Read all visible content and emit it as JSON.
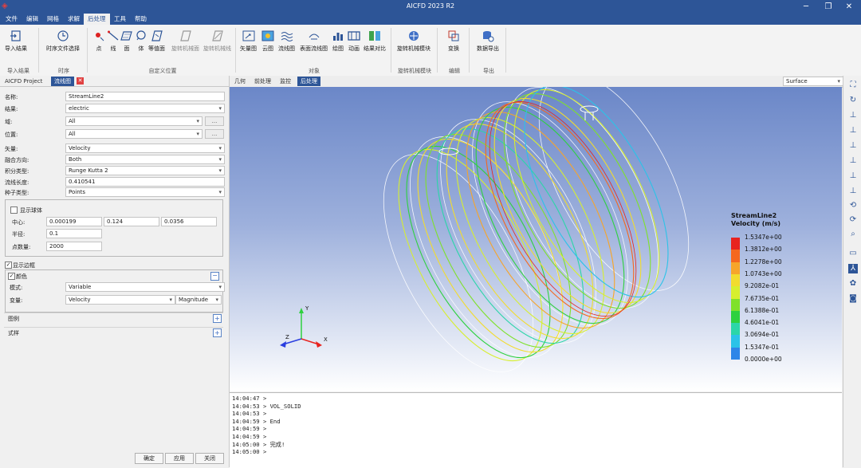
{
  "window": {
    "title": "AICFD 2023 R2"
  },
  "menu": [
    "文件",
    "编辑",
    "网格",
    "求解",
    "后处理",
    "工具",
    "帮助"
  ],
  "menu_active_index": 4,
  "ribbon": {
    "buttons": {
      "import_result": "导入结果",
      "time_file": "时序文件选择",
      "point": "点",
      "line": "线",
      "plane": "面",
      "volume": "体",
      "isosurface": "等值面",
      "rot_mach_surface": "旋转机械面",
      "rot_mach_line": "旋转机械线",
      "vector": "矢量图",
      "contour": "云图",
      "streamline": "流线图",
      "surface_streamline": "表面流线图",
      "plot": "绘图",
      "animation": "动画",
      "compare": "结果对比",
      "rot_mach_module": "旋转机械模块",
      "transform": "变换",
      "data_export": "数据导出"
    },
    "groups": {
      "import": "导入结果",
      "timing": "时序",
      "custom_position": "自定义位置",
      "object": "对象",
      "rot_mach": "旋转机械模块",
      "edit": "编辑",
      "export": "导出"
    }
  },
  "left_panel": {
    "tabs": [
      "AICFD Project",
      "流线图"
    ],
    "fields": {
      "name_label": "名称:",
      "name_value": "StreamLine2",
      "result_label": "结果:",
      "result_value": "electric",
      "domain_label": "域:",
      "domain_value": "All",
      "position_label": "位置:",
      "position_value": "All",
      "vector_label": "矢量:",
      "vector_value": "Velocity",
      "direction_label": "融合方向:",
      "direction_value": "Both",
      "integ_label": "积分类型:",
      "integ_value": "Runge Kutta 2",
      "length_label": "流线长度:",
      "length_value": "0.410541",
      "seed_label": "种子类型:",
      "seed_value": "Points",
      "ellipsis": "..."
    },
    "sphere": {
      "show_label": "显示球体",
      "center_label": "中心:",
      "center": [
        "0.000199",
        "0.124",
        "0.0356"
      ],
      "radius_label": "半径:",
      "radius": "0.1",
      "points_label": "点数量:",
      "points": "2000"
    },
    "show_border": "显示边框",
    "color": {
      "title": "颜色",
      "mode_label": "模式:",
      "mode_value": "Variable",
      "var_label": "变量:",
      "var_value": "Velocity",
      "component": "Magnitude"
    },
    "legend_section": "图例",
    "style_section": "式样",
    "buttons": {
      "ok": "确定",
      "apply": "应用",
      "close": "关闭"
    }
  },
  "view_tabs": [
    "几何",
    "前处理",
    "监控",
    "后处理"
  ],
  "view_active_index": 3,
  "view_mode": "Surface",
  "legend": {
    "title1": "StreamLine2",
    "title2": "Velocity (m/s)",
    "labels": [
      "1.5347e+00",
      "1.3812e+00",
      "1.2278e+00",
      "1.0743e+00",
      "9.2082e-01",
      "7.6735e-01",
      "6.1388e-01",
      "4.6041e-01",
      "3.0694e-01",
      "1.5347e-01",
      "0.0000e+00"
    ],
    "colors": [
      "#e8231f",
      "#f5681f",
      "#f7a52a",
      "#f2dc2e",
      "#d7ef2f",
      "#7fe12b",
      "#2ed13f",
      "#2bd6a8",
      "#2bc3e8",
      "#2e86e8",
      "#2a3ee0"
    ]
  },
  "axes": {
    "x": "X",
    "y": "Y",
    "z": "Z"
  },
  "console": [
    "14:04:47 >",
    "14:04:53 > VOL_SOLID",
    "14:04:53 >",
    "14:04:59 > End",
    "14:04:59 >",
    "14:04:59 >",
    "14:05:00 > 完成!",
    "14:05:00 >"
  ]
}
